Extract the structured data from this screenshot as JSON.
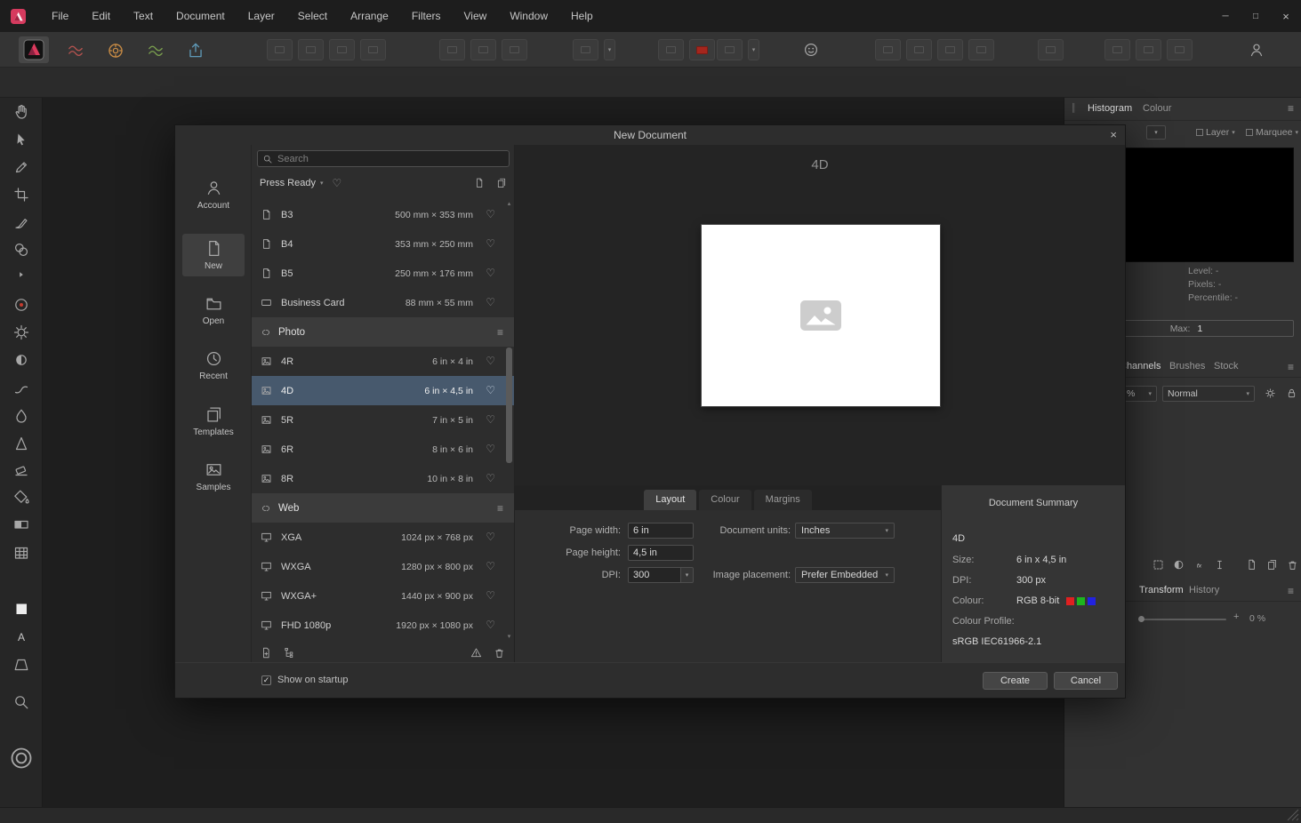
{
  "menubar": {
    "items": [
      "File",
      "Edit",
      "Text",
      "Document",
      "Layer",
      "Select",
      "Arrange",
      "Filters",
      "View",
      "Window",
      "Help"
    ]
  },
  "window_controls": {
    "minimize": "─",
    "maximize": "□",
    "close": "×"
  },
  "glyphs": {
    "hamburger": "≡",
    "handle": "║",
    "chevron_down": "▾",
    "heart": "♡",
    "check": "✓",
    "scroll_up": "▴",
    "scroll_down": "▾"
  },
  "tools": [
    {
      "name": "view-tool",
      "icon": "hand"
    },
    {
      "name": "move-tool",
      "icon": "cursor"
    },
    {
      "name": "colour-picker-tool",
      "icon": "pen"
    },
    {
      "name": "crop-tool",
      "icon": "crop"
    },
    {
      "name": "paint-brush-tool",
      "icon": "brush"
    },
    {
      "name": "clone-stamp-tool",
      "icon": "clone"
    },
    {
      "name": "tool-flyout",
      "icon": "chevron"
    },
    {
      "name": "red-eye-removal-tool",
      "icon": "heal"
    },
    {
      "name": "dodge-brush-tool",
      "icon": "dodge"
    },
    {
      "name": "burn-brush-tool",
      "icon": "burn"
    },
    {
      "name": "smudge-brush-tool",
      "icon": "smudge"
    },
    {
      "name": "blur-brush-tool",
      "icon": "blur"
    },
    {
      "name": "sharpen-brush-tool",
      "icon": "sharpen"
    },
    {
      "name": "erase-brush-tool",
      "icon": "erase"
    },
    {
      "name": "flood-fill-tool",
      "icon": "fill"
    },
    {
      "name": "gradient-tool",
      "icon": "gradient"
    },
    {
      "name": "mesh-warp-tool",
      "icon": "mesh"
    },
    {
      "name": "colour-swatch",
      "icon": "swatch"
    },
    {
      "name": "text-tool",
      "icon": "text"
    },
    {
      "name": "shape-tool",
      "icon": "shape"
    },
    {
      "name": "zoom-tool",
      "icon": "zoom"
    },
    {
      "name": "colour-selector",
      "icon": "ring"
    }
  ],
  "dialog": {
    "title": "New Document",
    "close_glyph": "×",
    "nav": [
      {
        "label": "Account",
        "icon": "account"
      },
      {
        "label": "New",
        "icon": "newdoc",
        "selected": true
      },
      {
        "label": "Open",
        "icon": "open"
      },
      {
        "label": "Recent",
        "icon": "recent"
      },
      {
        "label": "Templates",
        "icon": "templates"
      },
      {
        "label": "Samples",
        "icon": "samples"
      }
    ],
    "search_placeholder": "Search",
    "category_label": "Press Ready",
    "presets": [
      {
        "type": "preset",
        "icon": "print",
        "name": "B3",
        "size": "500 mm × 353 mm"
      },
      {
        "type": "preset",
        "icon": "print",
        "name": "B4",
        "size": "353 mm × 250 mm"
      },
      {
        "type": "preset",
        "icon": "print",
        "name": "B5",
        "size": "250 mm × 176 mm"
      },
      {
        "type": "preset",
        "icon": "card",
        "name": "Business Card",
        "size": "88 mm × 55 mm"
      },
      {
        "type": "section",
        "name": "Photo"
      },
      {
        "type": "preset",
        "icon": "photo",
        "name": "4R",
        "size": "6 in × 4 in"
      },
      {
        "type": "preset",
        "icon": "photo",
        "name": "4D",
        "size": "6 in × 4,5 in",
        "selected": true
      },
      {
        "type": "preset",
        "icon": "photo",
        "name": "5R",
        "size": "7 in × 5 in"
      },
      {
        "type": "preset",
        "icon": "photo",
        "name": "6R",
        "size": "8 in × 6 in"
      },
      {
        "type": "preset",
        "icon": "photo",
        "name": "8R",
        "size": "10 in × 8 in"
      },
      {
        "type": "section",
        "name": "Web"
      },
      {
        "type": "preset",
        "icon": "web",
        "name": "XGA",
        "size": "1024 px × 768 px"
      },
      {
        "type": "preset",
        "icon": "web",
        "name": "WXGA",
        "size": "1280 px × 800 px"
      },
      {
        "type": "preset",
        "icon": "web",
        "name": "WXGA+",
        "size": "1440 px × 900 px"
      },
      {
        "type": "preset",
        "icon": "web",
        "name": "FHD 1080p",
        "size": "1920 px × 1080 px"
      }
    ],
    "preview_title": "4D",
    "tabs": [
      {
        "label": "Layout",
        "selected": true
      },
      {
        "label": "Colour"
      },
      {
        "label": "Margins"
      }
    ],
    "form": {
      "page_width_label": "Page width:",
      "page_width_value": "6 in",
      "page_height_label": "Page height:",
      "page_height_value": "4,5 in",
      "dpi_label": "DPI:",
      "dpi_value": "300",
      "units_label": "Document units:",
      "units_value": "Inches",
      "placement_label": "Image placement:",
      "placement_value": "Prefer Embedded"
    },
    "summary": {
      "title": "Document Summary",
      "name": "4D",
      "size_label": "Size:",
      "size_value": "6 in x 4,5 in",
      "dpi_label": "DPI:",
      "dpi_value": "300 px",
      "colour_label": "Colour:",
      "colour_value": "RGB 8-bit",
      "swatches": [
        "#e02020",
        "#1db51d",
        "#2222e0"
      ],
      "profile_label": "Colour Profile:",
      "profile_value": "sRGB IEC61966-2.1"
    },
    "footer": {
      "startup_label": "Show on startup",
      "create_label": "Create",
      "cancel_label": "Cancel"
    }
  },
  "panels": {
    "histogram": {
      "tab_histogram": "Histogram",
      "tab_colour": "Colour",
      "layer_label": "Layer",
      "marquee_label": "Marquee",
      "stats": [
        "Level: -",
        "Pixels: -",
        "Percentile: -"
      ],
      "max_label": "Max:",
      "max_value": "1"
    },
    "channels": {
      "tab_channels": "Channels",
      "tab_brushes": "Brushes",
      "tab_stock": "Stock"
    },
    "blend": {
      "opacity": "%",
      "mode": "Normal"
    },
    "transform": {
      "tab_transform": "Transform",
      "tab_history": "History",
      "plus": "+",
      "zoom": "0 %"
    }
  }
}
